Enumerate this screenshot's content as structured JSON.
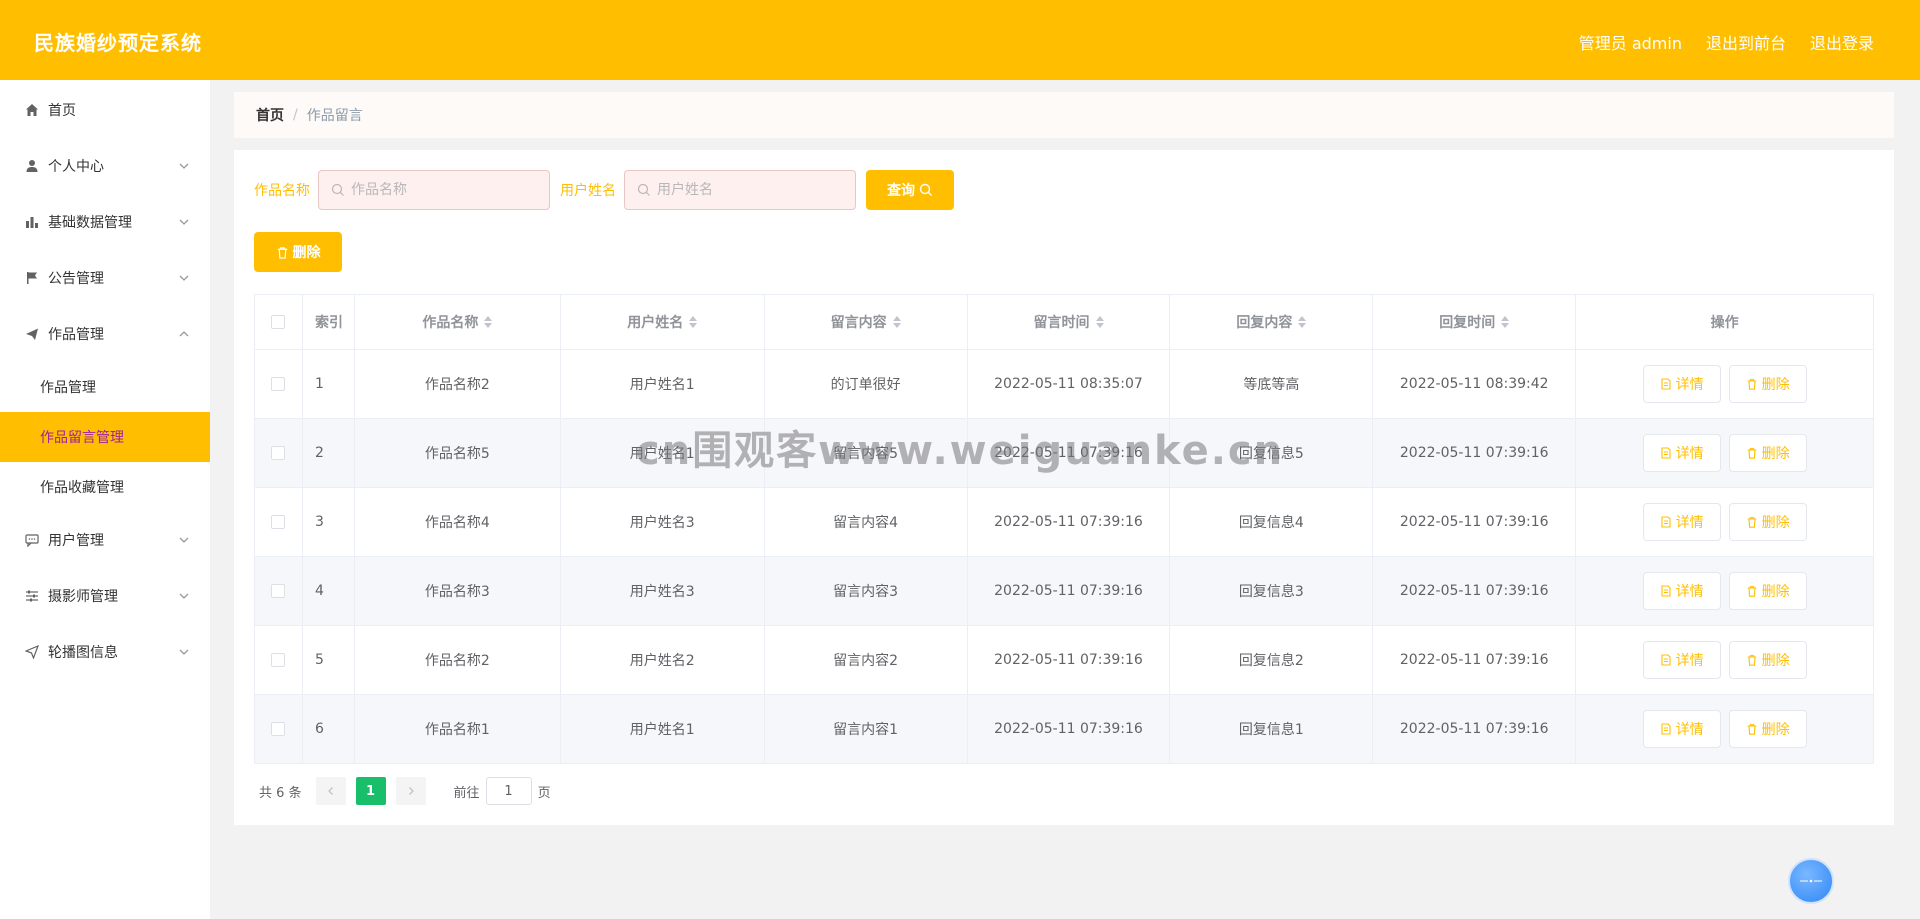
{
  "header": {
    "title": "民族婚纱预定系统",
    "admin_label": "管理员 admin",
    "to_front": "退出到前台",
    "logout": "退出登录"
  },
  "sidebar": {
    "items": [
      {
        "label": "首页",
        "icon": "home-icon"
      },
      {
        "label": "个人中心",
        "icon": "user-icon"
      },
      {
        "label": "基础数据管理",
        "icon": "bar-chart-icon"
      },
      {
        "label": "公告管理",
        "icon": "flag-icon"
      },
      {
        "label": "作品管理",
        "icon": "send-icon"
      },
      {
        "label": "用户管理",
        "icon": "chat-icon"
      },
      {
        "label": "摄影师管理",
        "icon": "sliders-icon"
      },
      {
        "label": "轮播图信息",
        "icon": "paper-plane-icon"
      }
    ],
    "sub_items": [
      "作品管理",
      "作品留言管理",
      "作品收藏管理"
    ]
  },
  "breadcrumb": {
    "home": "首页",
    "sep": "/",
    "current": "作品留言"
  },
  "search": {
    "work_label": "作品名称",
    "work_placeholder": "作品名称",
    "user_label": "用户姓名",
    "user_placeholder": "用户姓名",
    "query": "查询",
    "delete": "删除"
  },
  "table": {
    "headers": [
      "索引",
      "作品名称",
      "用户姓名",
      "留言内容",
      "留言时间",
      "回复内容",
      "回复时间",
      "操作"
    ],
    "rows": [
      [
        "1",
        "作品名称2",
        "用户姓名1",
        "的订单很好",
        "2022-05-11 08:35:07",
        "等底等高",
        "2022-05-11 08:39:42"
      ],
      [
        "2",
        "作品名称5",
        "用户姓名1",
        "留言内容5",
        "2022-05-11 07:39:16",
        "回复信息5",
        "2022-05-11 07:39:16"
      ],
      [
        "3",
        "作品名称4",
        "用户姓名3",
        "留言内容4",
        "2022-05-11 07:39:16",
        "回复信息4",
        "2022-05-11 07:39:16"
      ],
      [
        "4",
        "作品名称3",
        "用户姓名3",
        "留言内容3",
        "2022-05-11 07:39:16",
        "回复信息3",
        "2022-05-11 07:39:16"
      ],
      [
        "5",
        "作品名称2",
        "用户姓名2",
        "留言内容2",
        "2022-05-11 07:39:16",
        "回复信息2",
        "2022-05-11 07:39:16"
      ],
      [
        "6",
        "作品名称1",
        "用户姓名1",
        "留言内容1",
        "2022-05-11 07:39:16",
        "回复信息1",
        "2022-05-11 07:39:16"
      ]
    ],
    "detail_label": "详情",
    "delete_label": "删除"
  },
  "pagination": {
    "total": "共 6 条",
    "current": "1",
    "goto": "前往",
    "page_value": "1",
    "page_suffix": "页"
  },
  "watermark": "cn围观客www.weiguanke.cn",
  "colors": {
    "accent": "#ffbf00",
    "active_text": "#a020a0",
    "pager_active": "#19be6b"
  }
}
